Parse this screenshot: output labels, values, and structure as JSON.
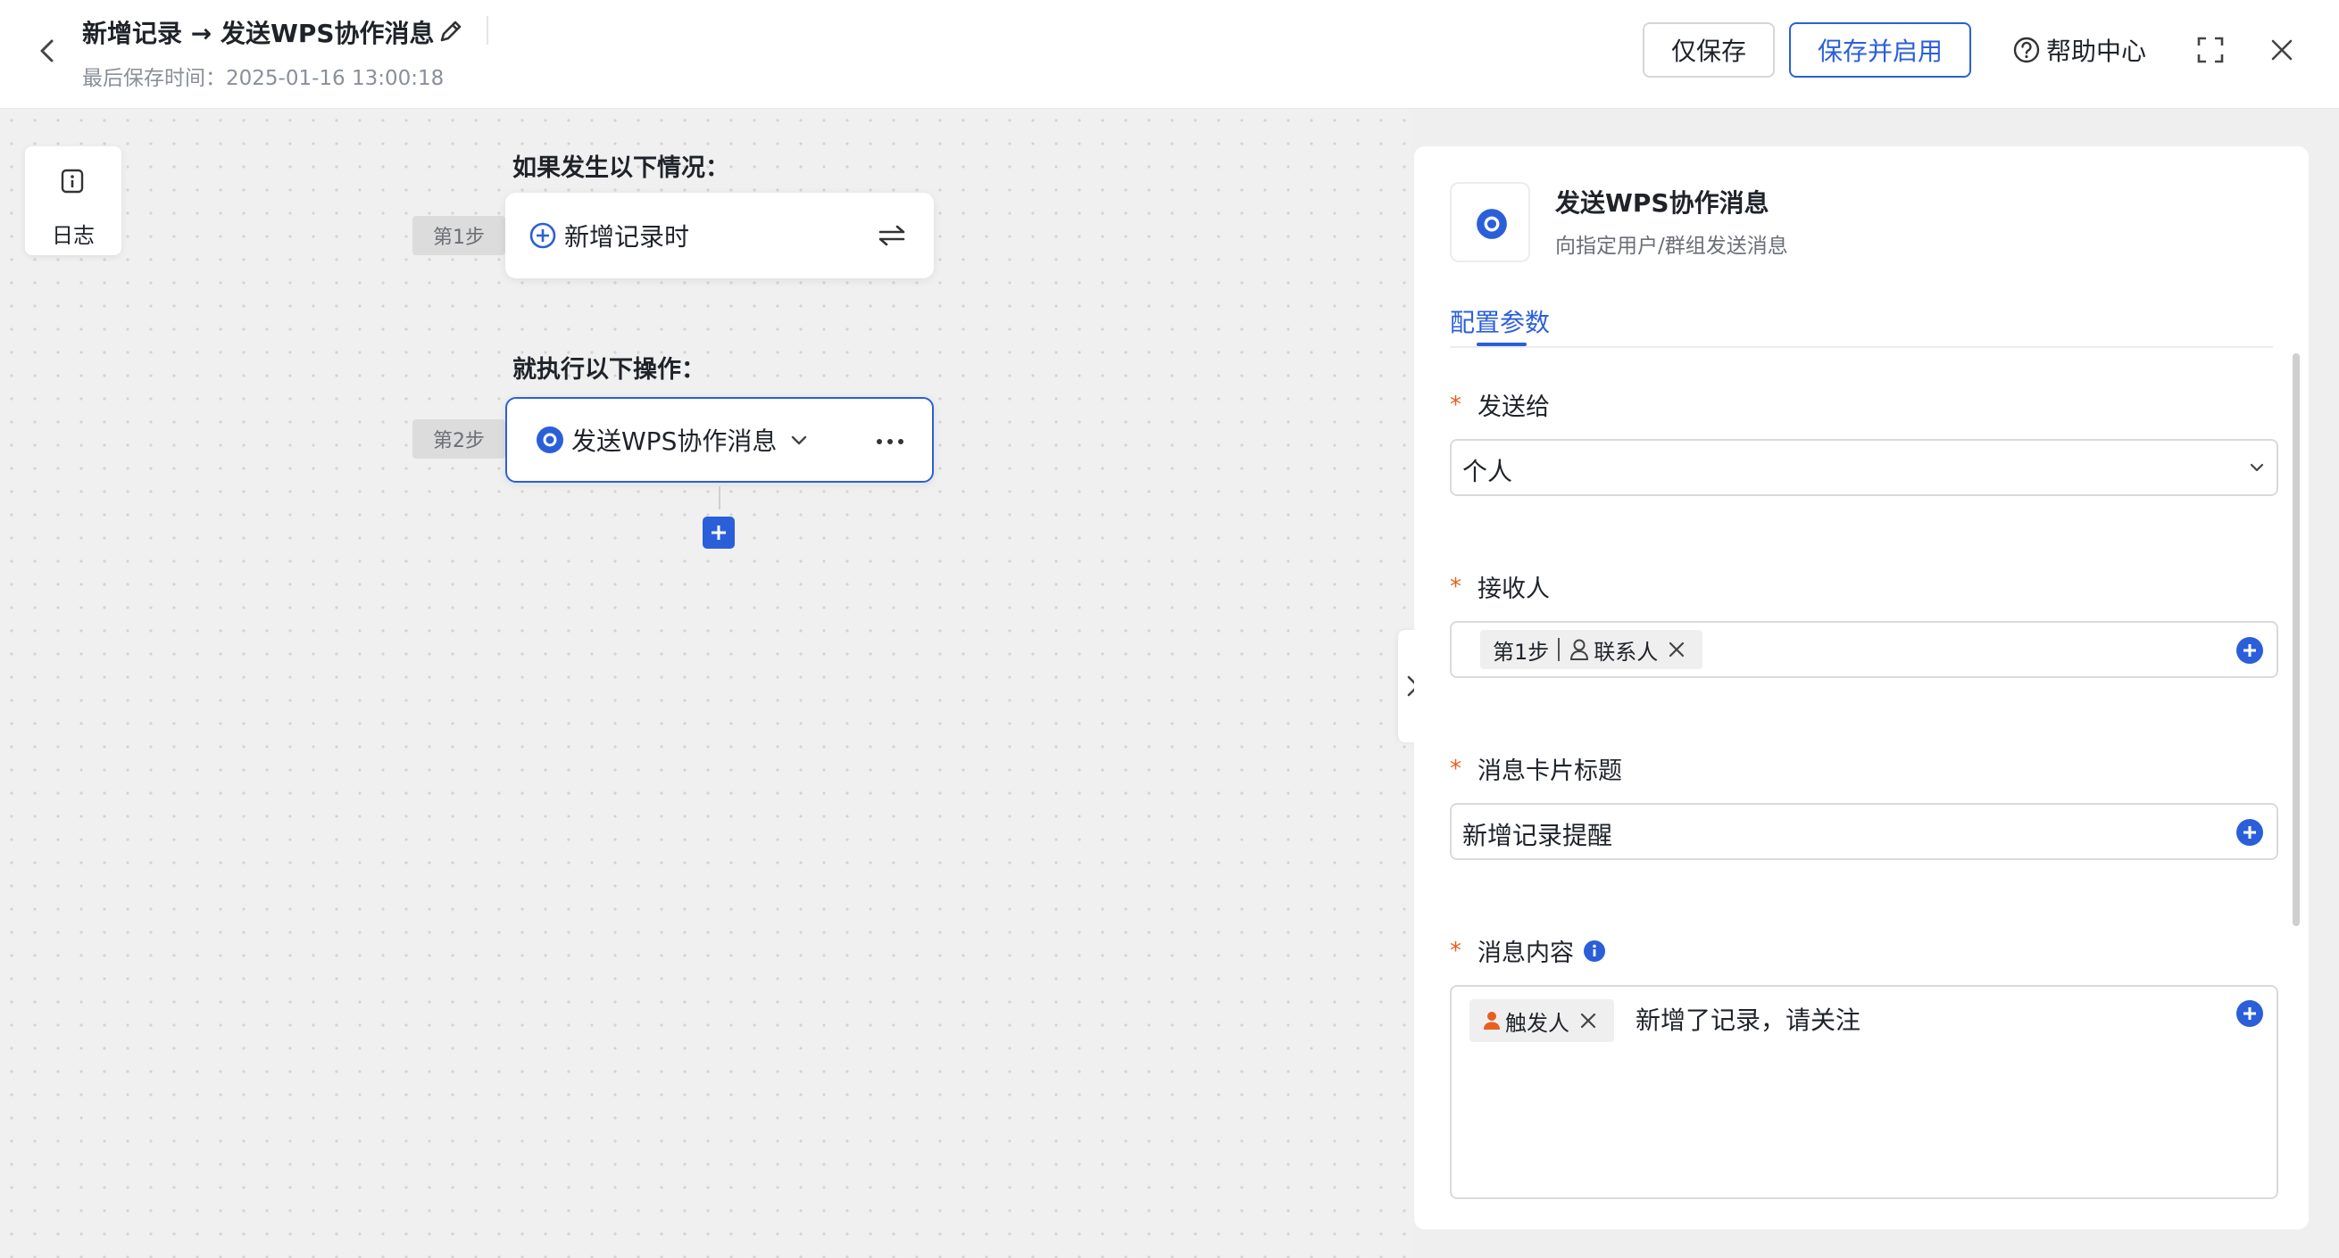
{
  "header": {
    "title": "新增记录 → 发送WPS协作消息",
    "subtitle": "最后保存时间：2025-01-16 13:00:18",
    "save_only": "仅保存",
    "save_enable": "保存并启用",
    "help": "帮助中心"
  },
  "sidebar": {
    "log_label": "日志"
  },
  "flow": {
    "trigger_label": "如果发生以下情况：",
    "action_label": "就执行以下操作：",
    "step1_tag": "第1步",
    "step2_tag": "第2步",
    "trigger_node": "新增记录时",
    "action_node": "发送WPS协作消息"
  },
  "panel": {
    "title": "发送WPS协作消息",
    "desc": "向指定用户/群组发送消息",
    "tab": "配置参数",
    "star": "*",
    "send_to_label": "发送给",
    "send_to_value": "个人",
    "receiver_label": "接收人",
    "receiver_chip_step": "第1步",
    "receiver_chip_field": "联系人",
    "card_title_label": "消息卡片标题",
    "card_title_value": "新增记录提醒",
    "content_label": "消息内容",
    "content_chip": "触发人",
    "content_text": "新增了记录，请关注"
  },
  "colors": {
    "accent": "#2b5fd9",
    "required": "#e5601f",
    "chip_person": "#e5601f"
  },
  "icons": [
    "back-icon",
    "edit-icon",
    "help-icon",
    "expand-icon",
    "close-icon",
    "info-icon",
    "plus-circle-icon",
    "swap-icon",
    "wps-icon",
    "chevron-down-icon",
    "more-icon",
    "add-icon",
    "chevron-right-icon",
    "person-icon",
    "remove-icon"
  ]
}
